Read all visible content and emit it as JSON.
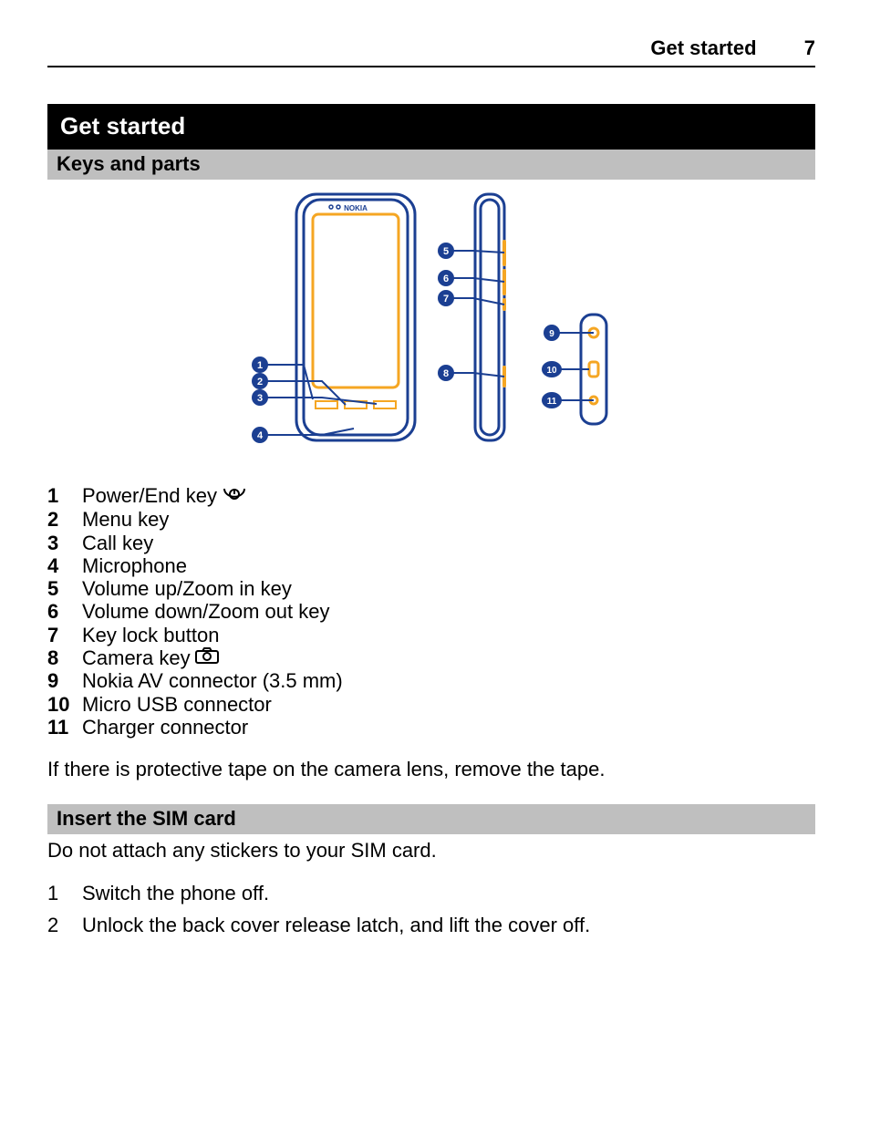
{
  "header": {
    "running_title": "Get started",
    "page_number": "7"
  },
  "chapter": {
    "title": "Get started"
  },
  "section1": {
    "title": "Keys and parts",
    "diagram": {
      "brand_label": "NOKIA",
      "callouts": [
        "1",
        "2",
        "3",
        "4",
        "5",
        "6",
        "7",
        "8",
        "9",
        "10",
        "11"
      ]
    },
    "parts": [
      {
        "n": "1",
        "label": "Power/End key",
        "icon": "power-end"
      },
      {
        "n": "2",
        "label": "Menu key"
      },
      {
        "n": "3",
        "label": "Call key"
      },
      {
        "n": "4",
        "label": "Microphone"
      },
      {
        "n": "5",
        "label": "Volume up/Zoom in key"
      },
      {
        "n": "6",
        "label": "Volume down/Zoom out key"
      },
      {
        "n": "7",
        "label": "Key lock button"
      },
      {
        "n": "8",
        "label": "Camera key",
        "icon": "camera"
      },
      {
        "n": "9",
        "label": "Nokia AV connector (3.5 mm)"
      },
      {
        "n": "10",
        "label": "Micro USB connector"
      },
      {
        "n": "11",
        "label": "Charger connector"
      }
    ],
    "note": "If there is protective tape on the camera lens, remove the tape."
  },
  "section2": {
    "title": "Insert the SIM card",
    "intro": "Do not attach any stickers to your SIM card.",
    "steps": [
      {
        "n": "1",
        "text": "Switch the phone off."
      },
      {
        "n": "2",
        "text": "Unlock the back cover release latch, and lift the cover off."
      }
    ]
  },
  "colors": {
    "callout_fill": "#1b3f92",
    "stroke_blue": "#1b3f92",
    "accent_orange": "#f5a623"
  }
}
